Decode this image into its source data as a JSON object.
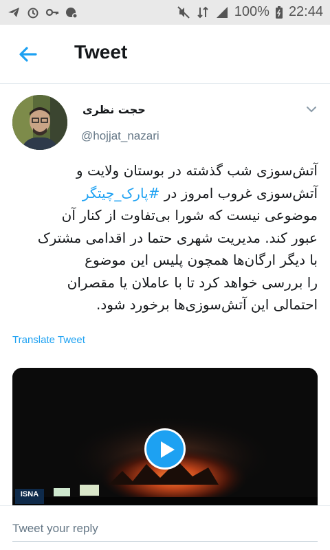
{
  "status_bar": {
    "battery": "100%",
    "time": "22:44",
    "left_icons": [
      "telegram-icon",
      "alarm-icon",
      "key-icon",
      "vpn-icon"
    ],
    "right_icons": [
      "mute-icon",
      "data-icon",
      "signal-icon",
      "battery-icon"
    ]
  },
  "appbar": {
    "title": "Tweet",
    "back_icon": "back-arrow-icon"
  },
  "tweet": {
    "author_name": "حجت نظری",
    "handle": "@hojjat_nazari",
    "body_lines": [
      {
        "before": "آتش‌سوزی شب گذشته در بوستان ولایت و",
        "hashtag": "",
        "after": ""
      },
      {
        "before": "آتش‌سوزی غروب امروز در ",
        "hashtag": "#پارک_چیتگر",
        "after": ""
      },
      {
        "before": "موضوعی نیست که شورا بی‌تفاوت از کنار آن",
        "hashtag": "",
        "after": ""
      },
      {
        "before": "عبور کند. مدیریت شهری حتما در اقدامی مشترک",
        "hashtag": "",
        "after": ""
      },
      {
        "before": "با دیگر ارگان‌ها همچون پلیس این موضوع",
        "hashtag": "",
        "after": ""
      },
      {
        "before": "را بررسی خواهد کرد تا با عاملان یا مقصران",
        "hashtag": "",
        "after": ""
      },
      {
        "before": "احتمالی این آتش‌سوزی‌ها برخورد شود.",
        "hashtag": "",
        "after": ""
      }
    ],
    "translate_label": "Translate Tweet",
    "media_badge": "ISNA"
  },
  "reply": {
    "placeholder": "Tweet your reply"
  },
  "colors": {
    "accent": "#1da1f2",
    "text": "#14171a",
    "secondary": "#657786",
    "status_bar": "#e9e9e9"
  }
}
